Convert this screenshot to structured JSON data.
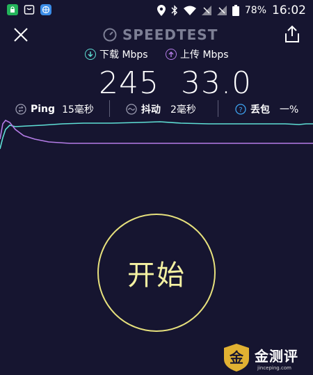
{
  "status_bar": {
    "battery": "78%",
    "time": "16:02"
  },
  "header": {
    "title": "SPEEDTEST"
  },
  "download": {
    "label": "下载 Mbps",
    "value": "245"
  },
  "upload": {
    "label": "上传 Mbps",
    "value": "33.0"
  },
  "stats": {
    "ping_label": "Ping",
    "ping_value": "15毫秒",
    "jitter_label": "抖动",
    "jitter_value": "2毫秒",
    "loss_label": "丢包",
    "loss_value": "一%"
  },
  "start_button": {
    "label": "开始"
  },
  "watermark": {
    "text": "金测评",
    "url": "jinceping.com"
  },
  "colors": {
    "background": "#161530",
    "download_line": "#5fe0d6",
    "upload_line": "#b57de8",
    "start_ring": "#e7e17d",
    "title_gray": "#7d7f95"
  }
}
